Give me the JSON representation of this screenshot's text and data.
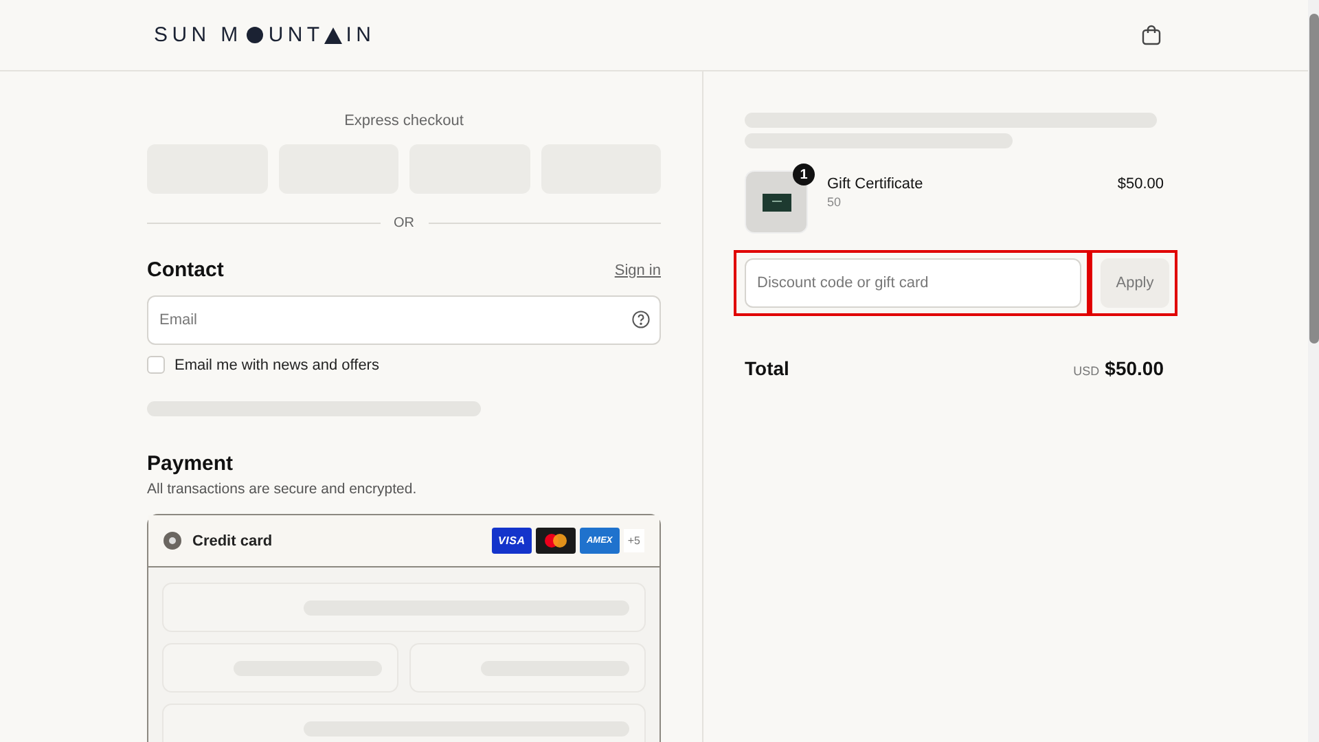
{
  "header": {
    "logo_parts": [
      "SUN M",
      "UNT",
      "IN"
    ]
  },
  "express_checkout": {
    "title": "Express checkout",
    "divider": "OR"
  },
  "contact": {
    "title": "Contact",
    "sign_in": "Sign in",
    "email": {
      "placeholder": "Email"
    },
    "newsletter": {
      "label": "Email me with news and offers",
      "checked": false
    }
  },
  "payment": {
    "title": "Payment",
    "subtitle": "All transactions are secure and encrypted.",
    "methods": [
      {
        "label": "Credit card",
        "selected": true,
        "cards": [
          {
            "kind": "visa",
            "text": "VISA"
          },
          {
            "kind": "mastercard"
          },
          {
            "kind": "amex",
            "text": "AMEX"
          }
        ],
        "more": "+5"
      }
    ]
  },
  "order": {
    "items": [
      {
        "name": "Gift Certificate",
        "variant": "50",
        "quantity": "1",
        "price": "$50.00"
      }
    ],
    "discount": {
      "placeholder": "Discount code or gift card",
      "button": "Apply",
      "highlighted": true
    },
    "total": {
      "label": "Total",
      "currency": "USD",
      "amount": "$50.00"
    }
  }
}
